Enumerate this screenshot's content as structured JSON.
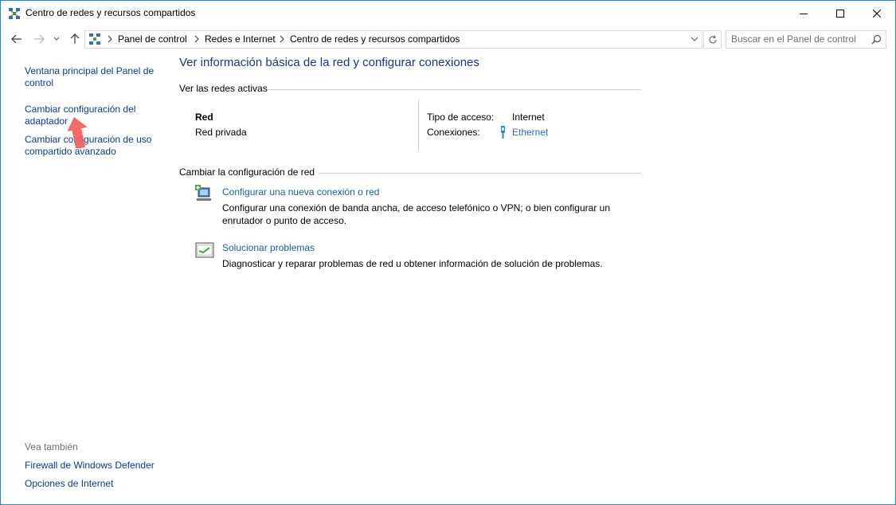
{
  "window": {
    "title": "Centro de redes y recursos compartidos"
  },
  "address": {
    "crumbs": [
      "Panel de control",
      "Redes e Internet",
      "Centro de redes y recursos compartidos"
    ]
  },
  "search": {
    "placeholder": "Buscar en el Panel de control"
  },
  "sidebar": {
    "links": [
      "Ventana principal del Panel de control",
      "Cambiar configuración del adaptador",
      "Cambiar configuración de uso compartido avanzado"
    ],
    "see_also_label": "Vea también",
    "see_also": [
      "Firewall de Windows Defender",
      "Opciones de Internet"
    ]
  },
  "main": {
    "title": "Ver información básica de la red y configurar conexiones",
    "active_networks_label": "Ver las redes activas",
    "network": {
      "name": "Red",
      "type": "Red privada",
      "access_label": "Tipo de acceso:",
      "access_value": "Internet",
      "connections_label": "Conexiones:",
      "connection_value": "Ethernet"
    },
    "change_settings_label": "Cambiar la configuración de red",
    "tasks": [
      {
        "title": "Configurar una nueva conexión o red",
        "desc": "Configurar una conexión de banda ancha, de acceso telefónico o VPN; o bien configurar un enrutador o punto de acceso.",
        "icon": "new-connection-icon"
      },
      {
        "title": "Solucionar problemas",
        "desc": "Diagnosticar y reparar problemas de red u obtener información de solución de problemas.",
        "icon": "troubleshoot-icon"
      }
    ]
  },
  "colors": {
    "link": "#1e5aa8",
    "heading": "#1e3287",
    "arrow": "#f0605a",
    "border": "#1883d7"
  }
}
